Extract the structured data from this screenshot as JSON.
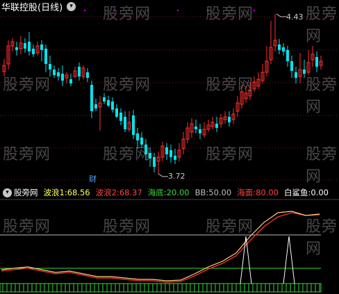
{
  "header": {
    "title": "华联控股(日线)",
    "menu_icon": "chevron-down-icon"
  },
  "annotations": {
    "high_price": "4.43",
    "low_price": "3.72",
    "finance_marker": "财"
  },
  "indicator": {
    "name": "股旁网",
    "items": [
      {
        "label": "波浪1:",
        "value": "68.56",
        "color": "#ffff55"
      },
      {
        "label": "波浪2:",
        "value": "68.37",
        "color": "#ff4040"
      },
      {
        "label": "海底:",
        "value": "20.00",
        "color": "#33dd33"
      },
      {
        "label": "BB:",
        "value": "50.00",
        "color": "#bbbbbb"
      },
      {
        "label": "海面:",
        "value": "80.00",
        "color": "#ff4040"
      },
      {
        "label": "白鲨鱼:",
        "value": "0.00",
        "color": "#ffffff"
      }
    ]
  },
  "watermark": "股旁网",
  "colors": {
    "up": "#ff3030",
    "down": "#00e5ee",
    "grid": "#8a1a1a",
    "wave1": "#ffffff",
    "wave2": "#ff3030",
    "sea_bottom": "#33dd33",
    "sea_top": "#bbbbbb"
  }
}
